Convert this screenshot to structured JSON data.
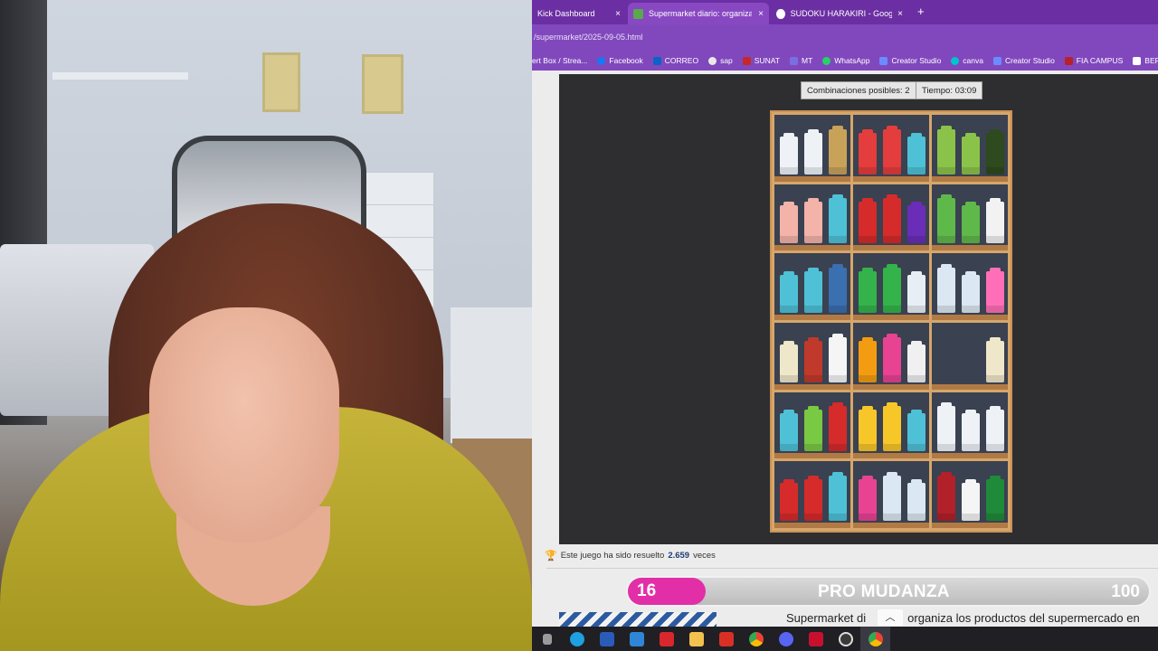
{
  "browser": {
    "tabs": [
      {
        "label": "Kick Dashboard",
        "active": false
      },
      {
        "label": "Supermarket diario: organiza lo",
        "active": true
      },
      {
        "label": "SUDOKU HARAKIRI - Google S",
        "active": false
      }
    ],
    "new_tab": "+",
    "close": "×",
    "address": "/supermarket/2025-09-05.html",
    "bookmarks": [
      {
        "label": "ert Box / Strea...",
        "icon": "folder-icon",
        "color": "#8148bd"
      },
      {
        "label": "Facebook",
        "icon": "facebook-icon",
        "color": "#1877f2"
      },
      {
        "label": "CORREO",
        "icon": "outlook-icon",
        "color": "#0a64c8"
      },
      {
        "label": "sap",
        "icon": "sap-icon",
        "color": "#e9e9e9"
      },
      {
        "label": "SUNAT",
        "icon": "sunat-icon",
        "color": "#c62828"
      },
      {
        "label": "MT",
        "icon": "mt-icon",
        "color": "#7b6fe0"
      },
      {
        "label": "WhatsApp",
        "icon": "whatsapp-icon",
        "color": "#25d366"
      },
      {
        "label": "Creator Studio",
        "icon": "creator-studio-icon",
        "color": "#6b8cff"
      },
      {
        "label": "canva",
        "icon": "canva-icon",
        "color": "#00c4cc"
      },
      {
        "label": "Creator Studio",
        "icon": "creator-studio-icon",
        "color": "#6b8cff"
      },
      {
        "label": "FIA CAMPUS",
        "icon": "fia-icon",
        "color": "#b8202a"
      },
      {
        "label": "BERLITZ",
        "icon": "berlitz-icon",
        "color": "#ffffff"
      }
    ]
  },
  "game": {
    "combinations_label": "Combinaciones posibles: 2",
    "time_label": "Tiempo: 03:09"
  },
  "solved": {
    "prefix": "Este juego ha sido resuelto",
    "count": "2.659",
    "suffix": "veces"
  },
  "banner": {
    "level": "16",
    "title": "PRO MUDANZA",
    "score": "100"
  },
  "article": {
    "title": "Supermarket di",
    "title_rest": "organiza los productos del supermercado en"
  },
  "colors": {
    "tabbar": "#6b2fa3",
    "badge": "#e22fa8",
    "shelf_wood": "#d6a66b"
  }
}
